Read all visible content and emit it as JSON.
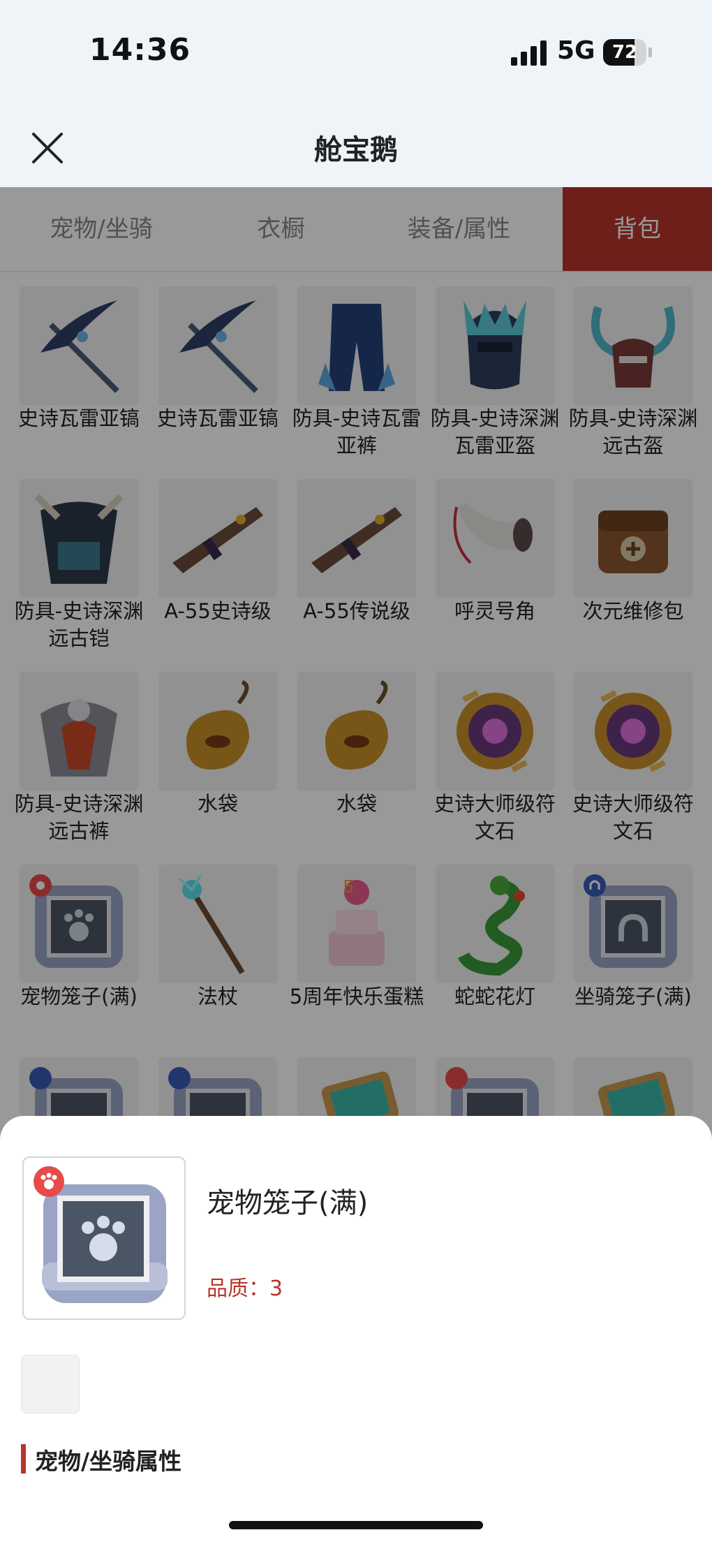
{
  "status_bar": {
    "time": "14:36",
    "network": "5G",
    "battery": "72",
    "battery_level": 0.72
  },
  "header": {
    "title": "舱宝鹅",
    "close_icon": "close-icon"
  },
  "tabs": [
    {
      "label": "宠物/坐骑",
      "active": false
    },
    {
      "label": "衣橱",
      "active": false
    },
    {
      "label": "装备/属性",
      "active": false
    },
    {
      "label": "背包",
      "active": true
    }
  ],
  "items": [
    {
      "name": "史诗瓦雷亚镐",
      "icon": "pickaxe-icon"
    },
    {
      "name": "史诗瓦雷亚镐",
      "icon": "pickaxe-icon"
    },
    {
      "name": "防具-史诗瓦雷亚裤",
      "icon": "armor-pants-icon"
    },
    {
      "name": "防具-史诗深渊瓦雷亚盔",
      "icon": "helmet-icon"
    },
    {
      "name": "防具-史诗深渊远古盔",
      "icon": "horned-helmet-icon"
    },
    {
      "name": "防具-史诗深渊远古铠",
      "icon": "chest-armor-icon"
    },
    {
      "name": "A-55史诗级",
      "icon": "rifle-icon"
    },
    {
      "name": "A-55传说级",
      "icon": "rifle-icon"
    },
    {
      "name": "呼灵号角",
      "icon": "horn-icon"
    },
    {
      "name": "次元维修包",
      "icon": "repair-bag-icon"
    },
    {
      "name": "防具-史诗深渊远古裤",
      "icon": "beast-armor-icon"
    },
    {
      "name": "水袋",
      "icon": "water-bag-icon"
    },
    {
      "name": "水袋",
      "icon": "water-bag-icon"
    },
    {
      "name": "史诗大师级符文石",
      "icon": "rune-stone-icon"
    },
    {
      "name": "史诗大师级符文石",
      "icon": "rune-stone-icon"
    },
    {
      "name": "宠物笼子(满)",
      "icon": "pet-cage-icon"
    },
    {
      "name": "法杖",
      "icon": "staff-icon"
    },
    {
      "name": "5周年快乐蛋糕",
      "icon": "cake-icon"
    },
    {
      "name": "蛇蛇花灯",
      "icon": "snake-lantern-icon"
    },
    {
      "name": "坐骑笼子(满)",
      "icon": "mount-cage-icon"
    },
    {
      "name": "",
      "icon": "mount-cage-icon"
    },
    {
      "name": "",
      "icon": "mount-cage-icon"
    },
    {
      "name": "",
      "icon": "tablet-icon"
    },
    {
      "name": "",
      "icon": "pet-cage-icon"
    },
    {
      "name": "",
      "icon": "tablet-icon"
    }
  ],
  "detail": {
    "name": "宠物笼子(满)",
    "quality": "品质：3",
    "icon": "pet-cage-icon",
    "section_title": "宠物/坐骑属性"
  },
  "colors": {
    "accent": "#b8342b",
    "header_bg": "#eef4f7"
  }
}
